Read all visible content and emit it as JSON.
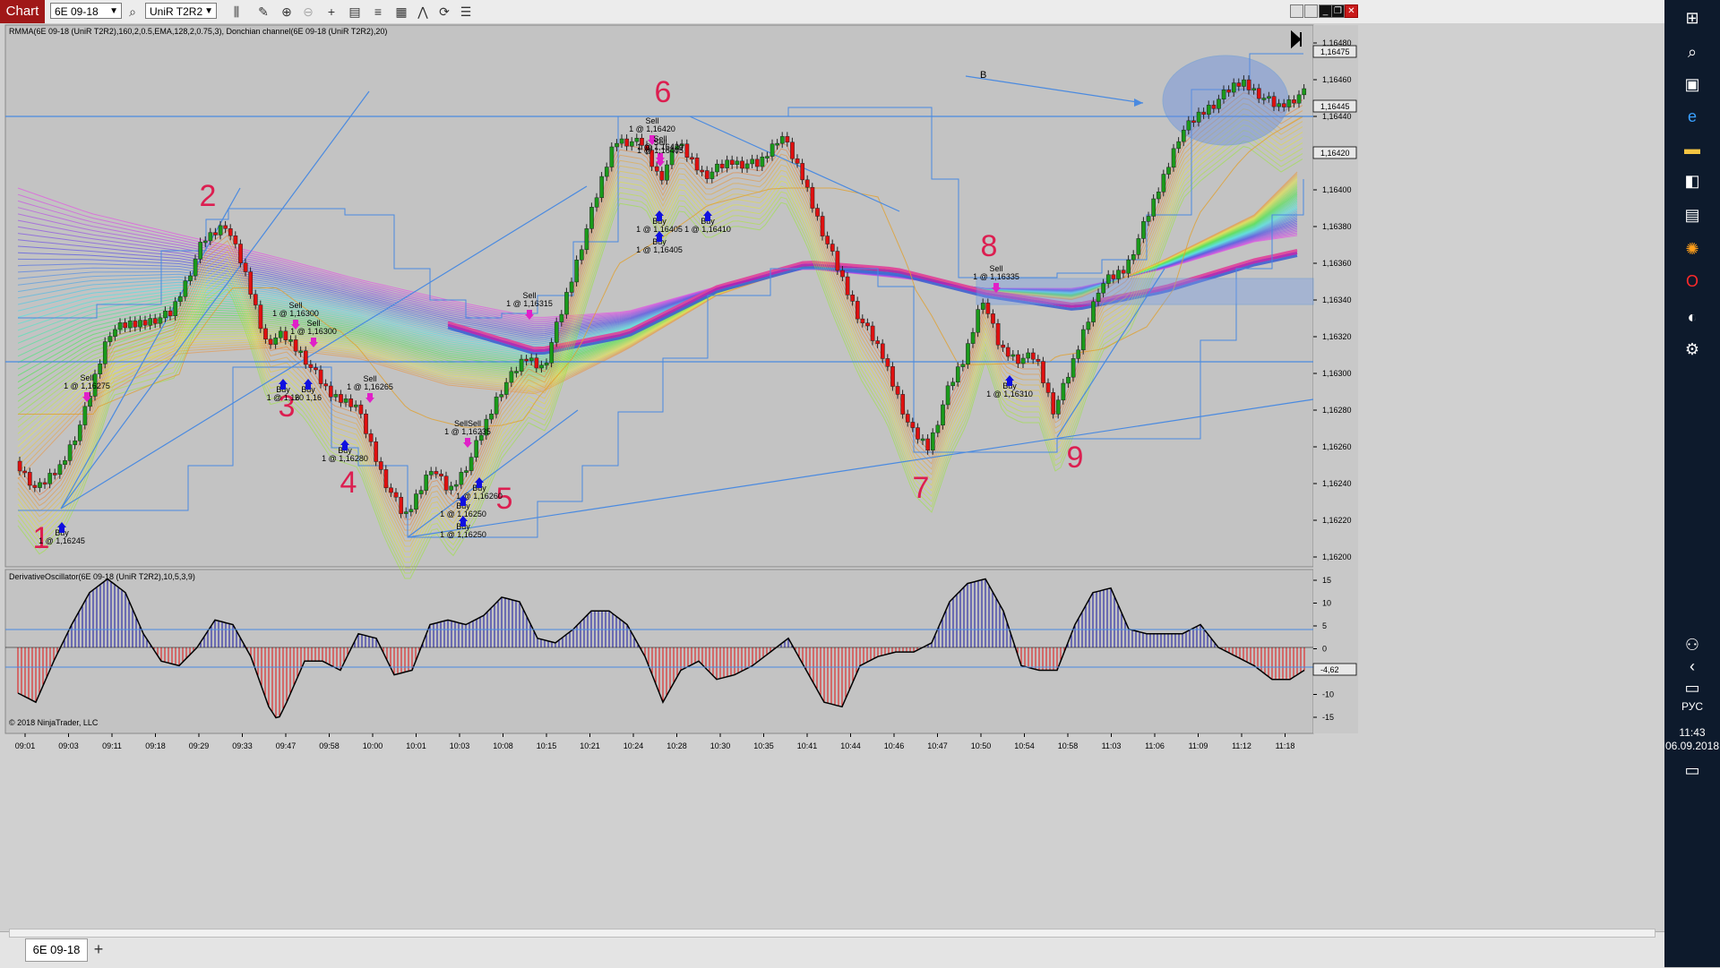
{
  "toolbar": {
    "chart_label": "Chart",
    "instrument": "6E 09-18",
    "bar_type": "UniR T2R2"
  },
  "panels": {
    "price_title": "RMMA(6E 09-18 (UniR T2R2),160,2,0.5,EMA,128,2,0.75,3), Donchian channel(6E 09-18 (UniR T2R2),20)",
    "osc_title": "DerivativeOscillator(6E 09-18 (UniR T2R2),10,5,3,9)",
    "copyright": "© 2018 NinjaTrader, LLC"
  },
  "price_axis": {
    "ticks": [
      "1,16480",
      "1,16460",
      "1,16440",
      "1,16420",
      "1,16400",
      "1,16380",
      "1,16360",
      "1,16340",
      "1,16320",
      "1,16300",
      "1,16280",
      "1,16260",
      "1,16240",
      "1,16220",
      "1,16200"
    ],
    "markers": [
      "1,16475",
      "1,16445",
      "1,16420"
    ]
  },
  "osc_axis": {
    "ticks": [
      "15",
      "10",
      "5",
      "0",
      "-5",
      "-10",
      "-15"
    ],
    "marker": "-4,62"
  },
  "time_axis": [
    "09:01",
    "09:03",
    "09:11",
    "09:18",
    "09:29",
    "09:33",
    "09:47",
    "09:58",
    "10:00",
    "10:01",
    "10:03",
    "10:08",
    "10:15",
    "10:21",
    "10:24",
    "10:28",
    "10:30",
    "10:35",
    "10:41",
    "10:44",
    "10:46",
    "10:47",
    "10:50",
    "10:54",
    "10:58",
    "11:03",
    "11:06",
    "11:09",
    "11:12",
    "11:18"
  ],
  "numbers": [
    "1",
    "2",
    "3",
    "4",
    "5",
    "6",
    "7",
    "8",
    "9"
  ],
  "label_b": "B",
  "trades": [
    {
      "side": "Sell",
      "price": "1 @ 1,16275"
    },
    {
      "side": "Buy",
      "price": "1 @ 1,16245"
    },
    {
      "side": "Sell",
      "price": "1 @ 1,16300"
    },
    {
      "side": "Sell",
      "price": "1 @ 1,16300"
    },
    {
      "side": "Buy",
      "price": "1 @ 1,16"
    },
    {
      "side": "Buy",
      "price": "20 1,16"
    },
    {
      "side": "Sell",
      "price": "1 @ 1,16265"
    },
    {
      "side": "Buy",
      "price": "1 @ 1,16280"
    },
    {
      "side": "Sell",
      "price": "1 @ 1,16315"
    },
    {
      "side": "SellSell",
      "price": "1 @ 1,16235"
    },
    {
      "side": "Buy",
      "price": "1 @ 1,16260"
    },
    {
      "side": "Buy",
      "price": "1 @ 1,16250"
    },
    {
      "side": "Buy",
      "price": "1 @ 1,16250"
    },
    {
      "side": "Sell",
      "price": "1 @ 1,16420"
    },
    {
      "side": "Sell",
      "price": "1 @ 1,16420"
    },
    {
      "side": "Sell",
      "price": "1 @ 1,16405"
    },
    {
      "side": "Buy",
      "price": "1 @ 1,16405"
    },
    {
      "side": "Buy",
      "price": "1 @ 1,16405"
    },
    {
      "side": "Buy",
      "price": "1 @ 1,16410"
    },
    {
      "side": "Sell",
      "price": "1 @ 1,16335"
    },
    {
      "side": "Buy",
      "price": "1 @ 1,16310"
    }
  ],
  "taskbar": {
    "time": "11:43",
    "date": "06.09.2018",
    "lang": "РУС"
  },
  "bottom": {
    "tab": "6E 09-18",
    "add": "+"
  },
  "colors": {
    "up": "#1a9a1a",
    "down": "#e01010",
    "line": "#4a8ae0",
    "osc_up": "#1414a0",
    "osc_down": "#e01010",
    "numbers": "#dc1e50"
  }
}
